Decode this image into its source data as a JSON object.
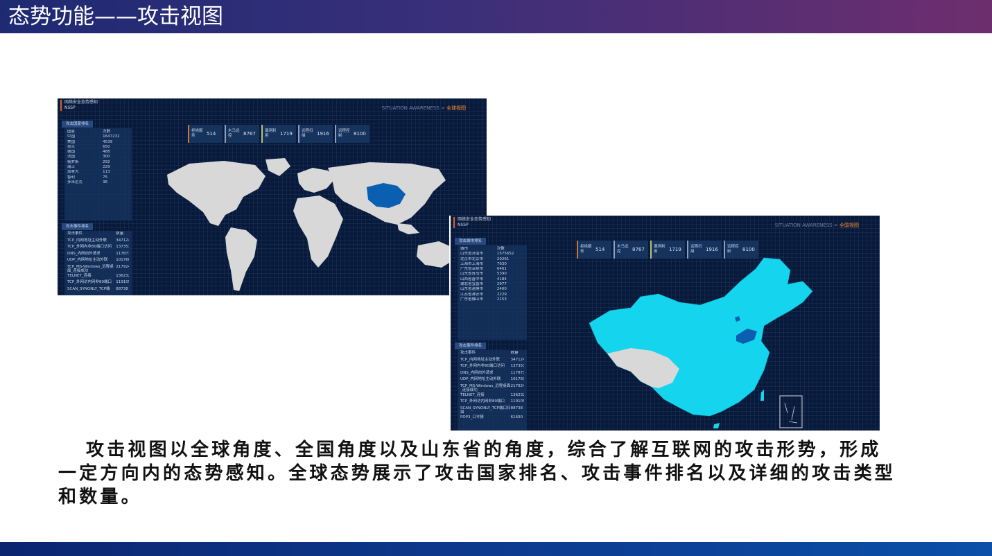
{
  "slide": {
    "title": "态势功能——攻击视图",
    "description": "攻击视图以全球角度、全国角度以及山东省的角度，综合了解互联网的攻击形势，形成一定方向内的态势感知。全球态势展示了攻击国家排名、攻击事件排名以及详细的攻击类型和数量。"
  },
  "colors": {
    "title_bar_start": "#1d2a72",
    "title_bar_end": "#6e2e6e",
    "dashboard_bg": "#081a3a",
    "highlight": "#ff8a2a",
    "china_fill": "#14d4ee",
    "hotspot": "#0a5fb0"
  },
  "global_view": {
    "app_title": "网络安全态势感知",
    "app_subtitle": "NSSP",
    "breadcrumb_prefix": "SITUATION AWARENESS >",
    "breadcrumb_current": "全球视图",
    "stats": [
      {
        "label": "拒绝服务",
        "value": "514"
      },
      {
        "label": "木马远控",
        "value": "8767"
      },
      {
        "label": "漏洞利用",
        "value": "1719"
      },
      {
        "label": "远程扫描",
        "value": "1916"
      },
      {
        "label": "远程控制",
        "value": "8100"
      }
    ],
    "country_panel": {
      "title": "攻击国家排名",
      "header": [
        "国家",
        "次数"
      ],
      "rows": [
        [
          "中国",
          "1647232"
        ],
        [
          "美国",
          "4539"
        ],
        [
          "荷兰",
          "650"
        ],
        [
          "德国",
          "488"
        ],
        [
          "法国",
          "300"
        ],
        [
          "俄罗斯",
          "292"
        ],
        [
          "瑞士",
          "229"
        ],
        [
          "加拿大",
          "113"
        ],
        [
          "智利",
          "75"
        ],
        [
          "多米尼克",
          "36"
        ]
      ]
    },
    "event_panel": {
      "title": "攻击事件排名",
      "header": [
        "攻击事件",
        "数量"
      ],
      "rows": [
        [
          "TCP_内网地址主动外联",
          "347124"
        ],
        [
          "TCP_外网内非80端口访问",
          "137353"
        ],
        [
          "DNS_内网向外请求",
          "117873"
        ],
        [
          "UDP_内网地址主动外联",
          "101760"
        ],
        [
          "TCP_MS-Windows_远程桌面_连接成功",
          "217924"
        ],
        [
          "TELNET_连接",
          "136232"
        ],
        [
          "TCP_外网访内网非80端口",
          "119105"
        ],
        [
          "SCAN_SYNONLY_TCP端",
          "88738"
        ]
      ]
    }
  },
  "china_view": {
    "app_title": "网络安全态势感知",
    "app_subtitle": "NSSP",
    "breadcrumb_prefix": "SITUATION AWARENESS >",
    "breadcrumb_current": "全国视图",
    "stats": [
      {
        "label": "拒绝服务",
        "value": "514"
      },
      {
        "label": "木马远控",
        "value": "8767"
      },
      {
        "label": "漏洞利用",
        "value": "1719"
      },
      {
        "label": "远程扫描",
        "value": "1916"
      },
      {
        "label": "远程控制",
        "value": "8100"
      }
    ],
    "city_panel": {
      "title": "攻击城市排名",
      "header": [
        "城市",
        "次数"
      ],
      "rows": [
        [
          "山东省济南市",
          "1575652"
        ],
        [
          "北京市北京市",
          "20261"
        ],
        [
          "上海市上海市",
          "7630"
        ],
        [
          "广东省深圳市",
          "6461"
        ],
        [
          "山东省青岛市",
          "5390"
        ],
        [
          "山西省晋中市",
          "4184"
        ],
        [
          "湖北省宜昌市",
          "2977"
        ],
        [
          "山东省淄博市",
          "2460"
        ],
        [
          "江苏省淮安市",
          "2229"
        ],
        [
          "广东省佛山市",
          "2153"
        ]
      ]
    },
    "event_panel": {
      "title": "攻击事件排名",
      "header": [
        "攻击事件",
        "数量"
      ],
      "rows": [
        [
          "TCP_内网地址主动外联",
          "347124"
        ],
        [
          "TCP_外网内非80端口访问",
          "137353"
        ],
        [
          "DNS_内网向外请求",
          "117873"
        ],
        [
          "UDP_内网地址主动外联",
          "101760"
        ],
        [
          "TCP_MS-Windows_远程桌面_连接成功",
          "217924"
        ],
        [
          "TELNET_连接",
          "136232"
        ],
        [
          "TCP_外网访内网非80端口",
          "119105"
        ],
        [
          "SCAN_SYNONLY_TCP端口扫描",
          "88738"
        ],
        [
          "POP3_口令猜",
          "61690"
        ]
      ]
    }
  }
}
